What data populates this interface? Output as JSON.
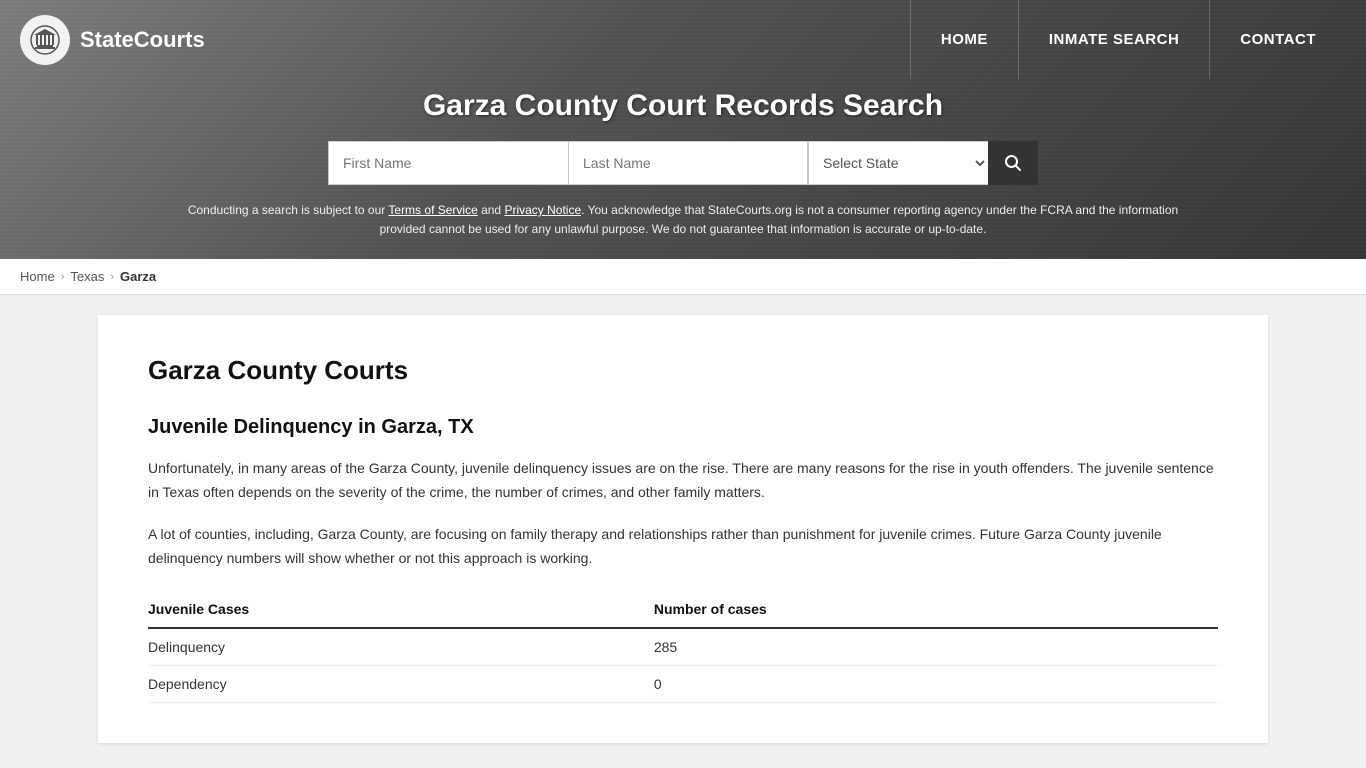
{
  "site": {
    "name": "StateCourts",
    "logo_icon": "🏛"
  },
  "nav": {
    "home_label": "HOME",
    "inmate_search_label": "INMATE SEARCH",
    "contact_label": "CONTACT"
  },
  "hero": {
    "title": "Garza County Court Records Search",
    "first_name_placeholder": "First Name",
    "last_name_placeholder": "Last Name",
    "state_select_default": "Select State",
    "search_icon": "🔍"
  },
  "disclaimer": {
    "text_before": "Conducting a search is subject to our ",
    "terms_label": "Terms of Service",
    "text_middle": " and ",
    "privacy_label": "Privacy Notice",
    "text_after": ". You acknowledge that StateCourts.org is not a consumer reporting agency under the FCRA and the information provided cannot be used for any unlawful purpose. We do not guarantee that information is accurate or up-to-date."
  },
  "breadcrumb": {
    "home": "Home",
    "state": "Texas",
    "county": "Garza"
  },
  "content": {
    "page_title": "Garza County Courts",
    "section_title": "Juvenile Delinquency in Garza, TX",
    "paragraph1": "Unfortunately, in many areas of the Garza County, juvenile delinquency issues are on the rise. There are many reasons for the rise in youth offenders. The juvenile sentence in Texas often depends on the severity of the crime, the number of crimes, and other family matters.",
    "paragraph2": "A lot of counties, including, Garza County, are focusing on family therapy and relationships rather than punishment for juvenile crimes. Future Garza County juvenile delinquency numbers will show whether or not this approach is working.",
    "table": {
      "col1_header": "Juvenile Cases",
      "col2_header": "Number of cases",
      "rows": [
        {
          "case_type": "Delinquency",
          "count": "285"
        },
        {
          "case_type": "Dependency",
          "count": "0"
        }
      ]
    }
  }
}
